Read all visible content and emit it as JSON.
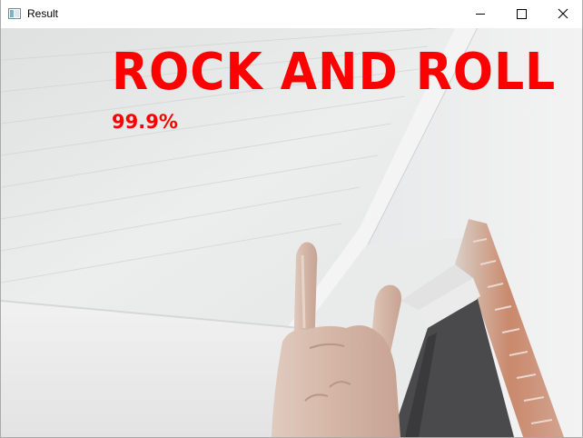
{
  "window": {
    "title": "Result",
    "icon": "opencv-window-icon",
    "controls": {
      "minimize_icon": "minimize-icon",
      "maximize_icon": "maximize-icon",
      "close_icon": "close-icon"
    }
  },
  "result": {
    "label": "ROCK AND ROLL",
    "confidence": "99.9%",
    "text_color": "#ff0000"
  },
  "camera_frame": {
    "subject": "hand making rock-and-roll gesture",
    "colors": {
      "ceiling": "#e6e8e8",
      "wall": "#eeeeef",
      "brick": "#c88b6e",
      "doorway": "#4a4a4d",
      "skin": "#d2b5a6"
    }
  }
}
